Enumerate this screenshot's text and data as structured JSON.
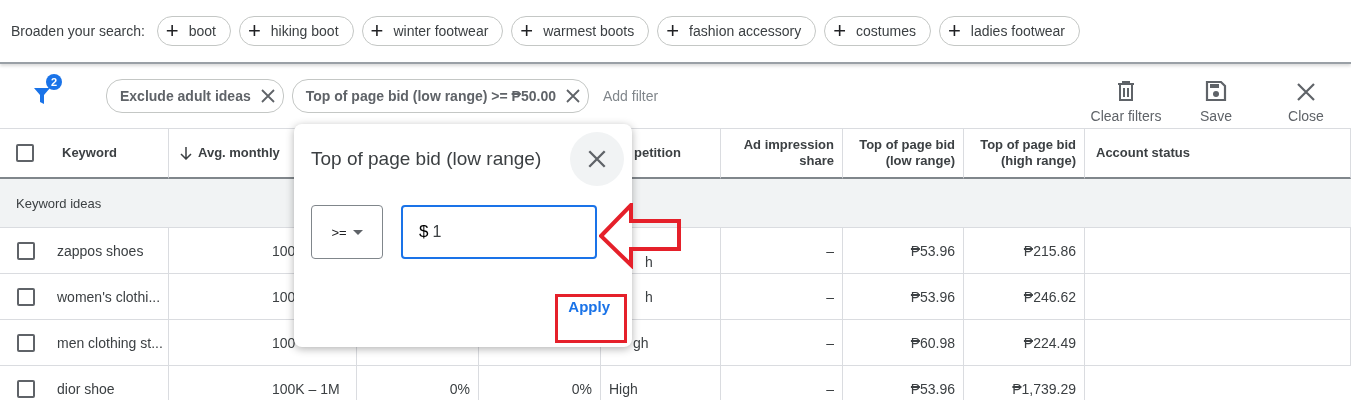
{
  "broaden": {
    "label": "Broaden your search:",
    "chips": [
      {
        "icon": "+",
        "label": "boot"
      },
      {
        "icon": "+",
        "label": "hiking boot"
      },
      {
        "icon": "+",
        "label": "winter footwear"
      },
      {
        "icon": "+",
        "label": "warmest boots"
      },
      {
        "icon": "+",
        "label": "fashion accessory"
      },
      {
        "icon": "+",
        "label": "costumes"
      },
      {
        "icon": "+",
        "label": "ladies footwear"
      }
    ]
  },
  "filter_bar": {
    "badge": "2",
    "filters": [
      {
        "label": "Exclude adult ideas"
      },
      {
        "label": "Top of page bid (low range) >= ₱50.00"
      }
    ],
    "add_filter": "Add filter",
    "actions": [
      {
        "kind": "clear",
        "label": "Clear filters"
      },
      {
        "kind": "save",
        "label": "Save"
      },
      {
        "kind": "close",
        "label": "Close"
      }
    ]
  },
  "table": {
    "select_all_checked": false,
    "columns": [
      {
        "label": "Keyword"
      },
      {
        "label": "Avg. monthly",
        "sorted": true
      },
      {},
      {},
      {
        "label": "petition"
      },
      {
        "label": "Ad impression share"
      },
      {
        "label": "Top of page bid (low range)"
      },
      {
        "label": "Top of page bid (high range)"
      },
      {
        "label": "Account status"
      }
    ],
    "group": "Keyword ideas",
    "rows": [
      {
        "checked": false,
        "covered": true,
        "cells": [
          "zappos shoes",
          "100",
          "",
          "",
          "h",
          "–",
          "₱53.96",
          "₱215.86",
          ""
        ]
      },
      {
        "checked": false,
        "covered": true,
        "cells": [
          "women's clothi...",
          "100",
          "",
          "",
          "h",
          "–",
          "₱53.96",
          "₱246.62",
          ""
        ]
      },
      {
        "checked": false,
        "covered": true,
        "cells": [
          "men clothing st...",
          "100",
          "",
          "",
          "gh",
          "–",
          "₱60.98",
          "₱224.49",
          ""
        ]
      },
      {
        "checked": false,
        "covered": false,
        "cells": [
          "dior shoe",
          "100K – 1M",
          "0%",
          "0%",
          "High",
          "–",
          "₱53.96",
          "₱1,739.29",
          ""
        ]
      }
    ]
  },
  "popup": {
    "title": "Top of page bid (low range)",
    "operator": ">=",
    "prefix": "$",
    "value": "1",
    "apply": "Apply"
  }
}
